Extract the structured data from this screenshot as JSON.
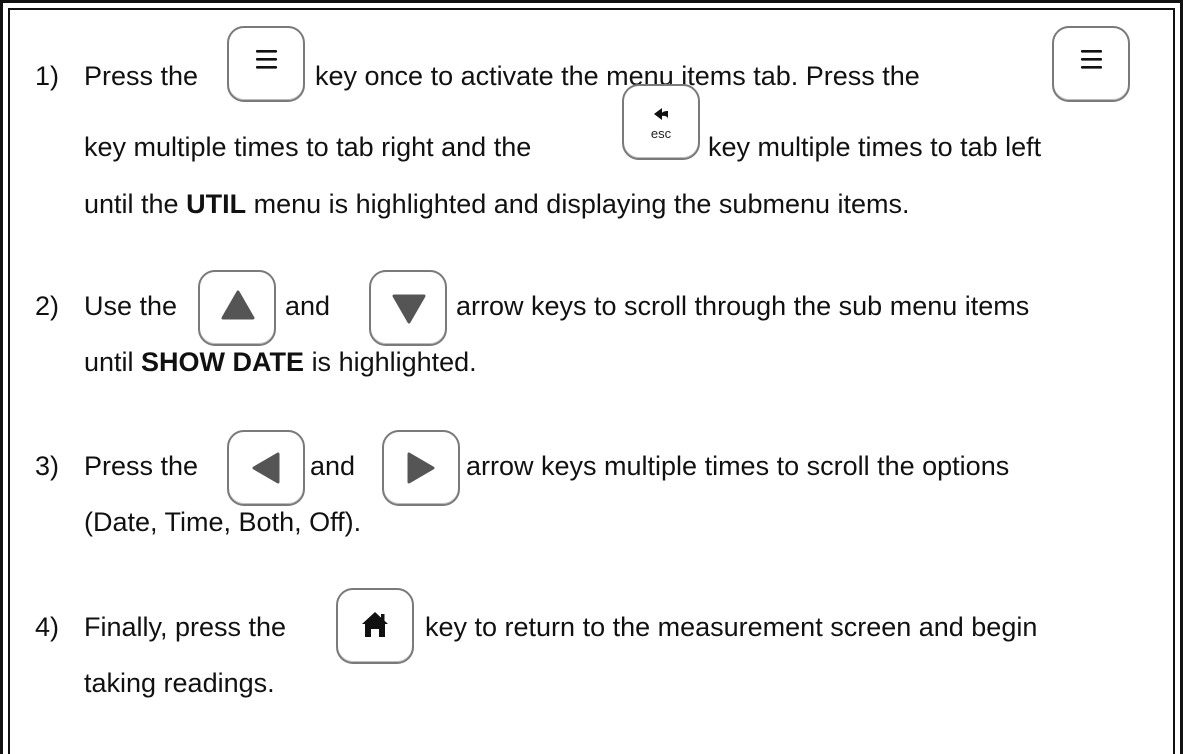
{
  "steps": [
    {
      "number": "1)",
      "line1_a": "Press the",
      "line1_b": "key once to activate the menu items tab.  Press the",
      "line2_b": "key multiple times to tab right and the",
      "line2_c": "key multiple times to tab left",
      "line3_a": "until the",
      "line3_bold": "UTIL",
      "line3_b": "menu is highlighted and displaying the submenu items."
    },
    {
      "number": "2)",
      "line1_a": "Use the",
      "line1_and": "and",
      "line1_b": "arrow keys to scroll through the sub menu items",
      "line2_a": "until",
      "line2_bold": "SHOW DATE",
      "line2_b": "is highlighted."
    },
    {
      "number": "3)",
      "line1_a": "Press the",
      "line1_and": "and",
      "line1_b": "arrow keys multiple times to scroll the options",
      "line2_a": "(Date, Time, Both, Off)."
    },
    {
      "number": "4)",
      "line1_a": "Finally, press the",
      "line1_b": "key to return to the measurement screen and begin",
      "line2_a": "taking readings."
    }
  ],
  "keys": {
    "menu": "menu-icon",
    "esc": "esc",
    "up": "up-arrow-icon",
    "down": "down-arrow-icon",
    "left": "left-arrow-icon",
    "right": "right-arrow-icon",
    "home": "home-icon"
  }
}
